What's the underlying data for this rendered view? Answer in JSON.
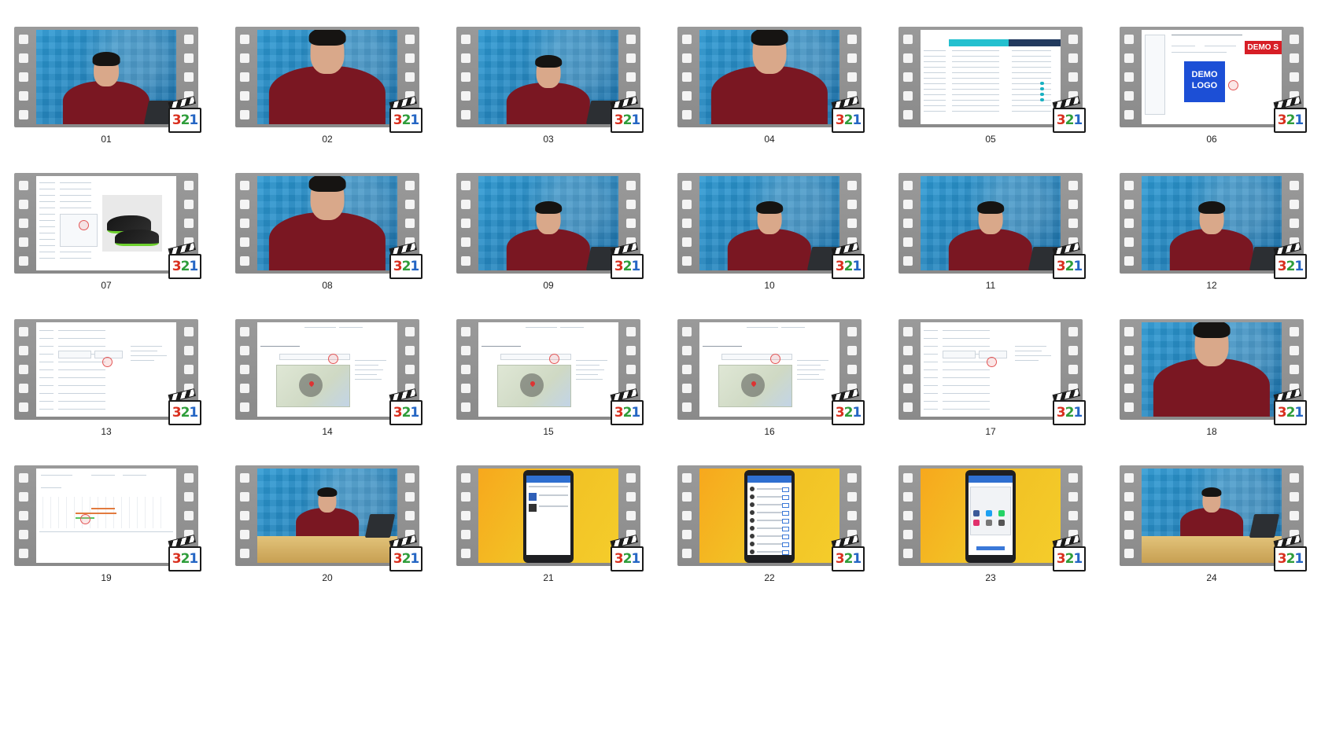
{
  "badge": {
    "digits": [
      "3",
      "2",
      "1"
    ]
  },
  "overlay_text": {
    "frame_01": ""
  },
  "thumbnails": [
    {
      "label": "01",
      "scene": "presenter-title"
    },
    {
      "label": "02",
      "scene": "presenter-close"
    },
    {
      "label": "03",
      "scene": "presenter-mid"
    },
    {
      "label": "04",
      "scene": "presenter-close"
    },
    {
      "label": "05",
      "scene": "screen-table"
    },
    {
      "label": "06",
      "scene": "screen-logo"
    },
    {
      "label": "07",
      "scene": "screen-product"
    },
    {
      "label": "08",
      "scene": "presenter-close"
    },
    {
      "label": "09",
      "scene": "presenter-mid"
    },
    {
      "label": "10",
      "scene": "presenter-mid"
    },
    {
      "label": "11",
      "scene": "presenter-mid"
    },
    {
      "label": "12",
      "scene": "presenter-mid"
    },
    {
      "label": "13",
      "scene": "screen-form"
    },
    {
      "label": "14",
      "scene": "screen-map"
    },
    {
      "label": "15",
      "scene": "screen-map"
    },
    {
      "label": "16",
      "scene": "screen-map"
    },
    {
      "label": "17",
      "scene": "screen-form"
    },
    {
      "label": "18",
      "scene": "presenter-close"
    },
    {
      "label": "19",
      "scene": "screen-chart"
    },
    {
      "label": "20",
      "scene": "presenter-desk"
    },
    {
      "label": "21",
      "scene": "phone-list"
    },
    {
      "label": "22",
      "scene": "phone-contacts"
    },
    {
      "label": "23",
      "scene": "phone-share"
    },
    {
      "label": "24",
      "scene": "presenter-desk"
    }
  ],
  "logo_box": {
    "line1": "DEMO",
    "line2": "LOGO"
  },
  "demo_tag": "DEMO S"
}
